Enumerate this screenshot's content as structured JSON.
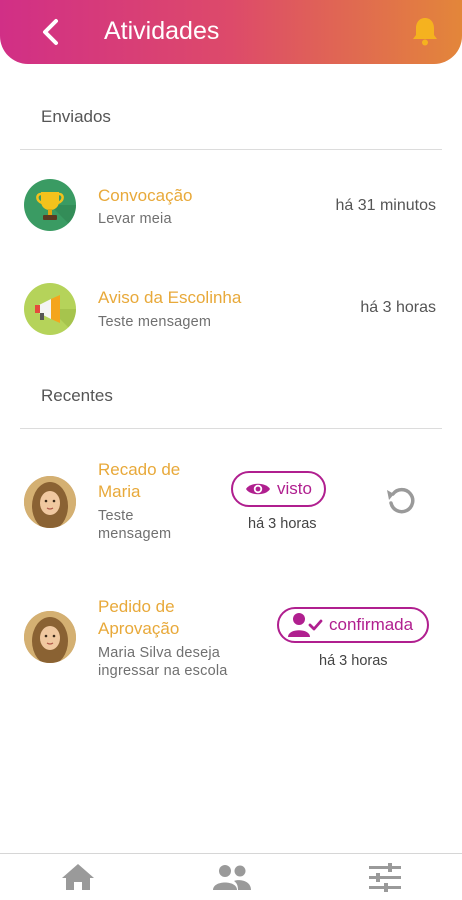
{
  "header": {
    "title": "Atividades",
    "back_icon": "back-chevron-icon",
    "notify_icon": "bell-icon"
  },
  "sections": {
    "sent": "Enviados",
    "recent": "Recentes"
  },
  "sent_items": [
    {
      "title": "Convocação",
      "subtitle": "Levar meia",
      "time": "há 31 minutos",
      "icon": "trophy-icon"
    },
    {
      "title": "Aviso da Escolinha",
      "subtitle": "Teste mensagem",
      "time": "há 3 horas",
      "icon": "megaphone-icon"
    }
  ],
  "recent_items": [
    {
      "title_line1": "Recado de",
      "title_line2": "Maria",
      "sub_line1": "Teste",
      "sub_line2": "mensagem",
      "badge": "visto",
      "badge_icon": "eye-icon",
      "time": "há 3 horas",
      "action_icon": "undo-icon"
    },
    {
      "title_line1": "Pedido de",
      "title_line2": "Aprovação",
      "sub_line1": "Maria Silva deseja",
      "sub_line2": "ingressar na escola",
      "badge": "confirmada",
      "badge_icon": "user-check-icon",
      "time": "há 3 horas"
    }
  ],
  "nav": [
    {
      "icon": "home-icon"
    },
    {
      "icon": "people-icon"
    },
    {
      "icon": "sliders-icon"
    }
  ],
  "colors": {
    "accent_gradient_start": "#d12f86",
    "accent_gradient_end": "#e3863a",
    "title_color": "#e8a93a",
    "badge_color": "#b01f8f"
  }
}
